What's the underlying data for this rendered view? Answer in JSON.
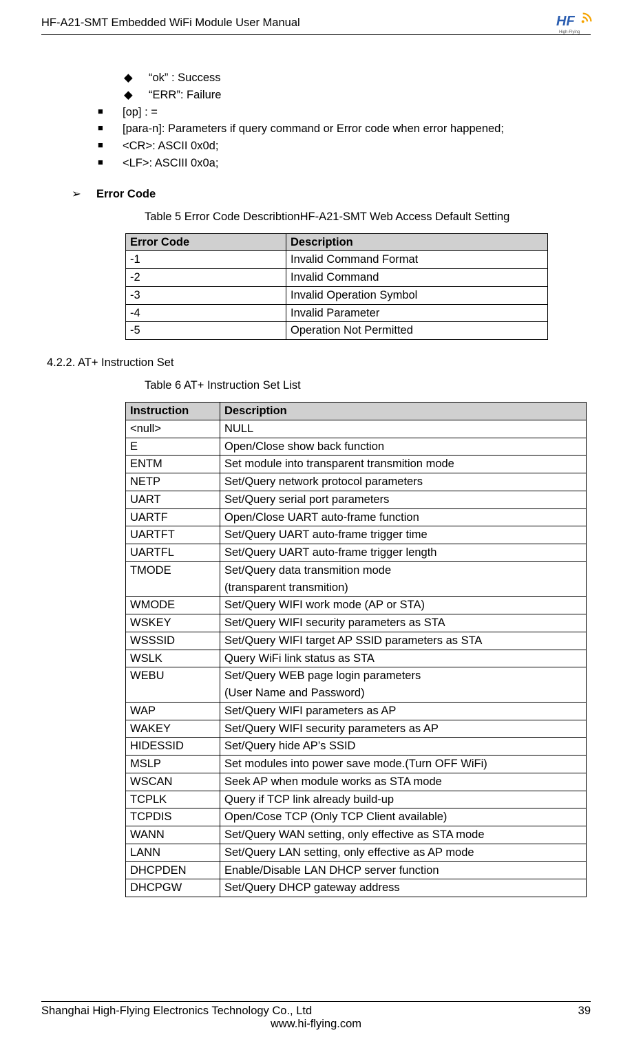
{
  "header": {
    "title": "HF-A21-SMT  Embedded WiFi Module User Manual",
    "logo_text": "HF",
    "logo_sub": "High-Flying"
  },
  "bullets_diamond": [
    "“ok” : Success",
    "“ERR”: Failure"
  ],
  "bullets_square": [
    "[op] : =",
    "[para-n]: Parameters if query command or Error code when error happened;",
    "<CR>:  ASCII  0x0d;",
    "<LF>:   ASCIII  0x0a;"
  ],
  "error_code_heading": "Error Code",
  "table5_caption": "Table 5     Error Code DescribtionHF-A21-SMT Web Access Default Setting",
  "table5": {
    "headers": [
      "Error Code",
      "Description"
    ],
    "rows": [
      [
        "-1",
        "Invalid Command Format"
      ],
      [
        "-2",
        "Invalid Command"
      ],
      [
        "-3",
        "Invalid Operation Symbol"
      ],
      [
        "-4",
        "Invalid Parameter"
      ],
      [
        "-5",
        "Operation Not Permitted"
      ]
    ]
  },
  "section_422": "4.2.2.    AT+ Instruction Set",
  "table6_caption": "Table 6     AT+ Instruction Set List",
  "table6": {
    "headers": [
      "Instruction",
      "Description"
    ],
    "rows": [
      [
        "<null>",
        "NULL"
      ],
      [
        "E",
        "Open/Close show back function"
      ],
      [
        "ENTM",
        "Set module into transparent transmition mode"
      ],
      [
        "NETP",
        "Set/Query network protocol parameters"
      ],
      [
        "UART",
        "Set/Query serial port parameters"
      ],
      [
        "UARTF",
        "Open/Close UART auto-frame function"
      ],
      [
        "UARTFT",
        "Set/Query UART auto-frame trigger time"
      ],
      [
        "UARTFL",
        "Set/Query UART auto-frame trigger length"
      ],
      [
        "TMODE",
        "Set/Query data transmition mode\n(transparent transmition)"
      ],
      [
        "WMODE",
        "Set/Query WIFI work mode (AP or STA)"
      ],
      [
        "WSKEY",
        "Set/Query WIFI security parameters as STA"
      ],
      [
        "WSSSID",
        "Set/Query WIFI target AP SSID parameters as STA"
      ],
      [
        "WSLK",
        "Query WiFi link status as STA"
      ],
      [
        "WEBU",
        "Set/Query WEB page login parameters\n(User Name and Password)"
      ],
      [
        "WAP",
        "Set/Query WIFI parameters as AP"
      ],
      [
        "WAKEY",
        "Set/Query WIFI security parameters as AP"
      ],
      [
        "HIDESSID",
        "Set/Query hide AP’s SSID"
      ],
      [
        "MSLP",
        "Set modules into power save mode.(Turn OFF WiFi)"
      ],
      [
        "WSCAN",
        "Seek AP when module works as STA mode"
      ],
      [
        "TCPLK",
        "Query if TCP link already build-up"
      ],
      [
        "TCPDIS",
        "Open/Cose TCP (Only TCP Client available)"
      ],
      [
        "WANN",
        "Set/Query WAN setting, only effective as STA mode"
      ],
      [
        "LANN",
        "Set/Query LAN setting, only effective as AP mode"
      ],
      [
        "DHCPDEN",
        "Enable/Disable LAN  DHCP server function"
      ],
      [
        "DHCPGW",
        "Set/Query DHCP gateway address"
      ]
    ]
  },
  "footer": {
    "company": "Shanghai High-Flying Electronics Technology Co., Ltd",
    "url": "www.hi-flying.com",
    "page": "39"
  }
}
